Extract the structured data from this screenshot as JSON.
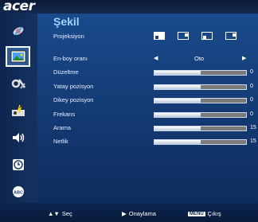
{
  "brand": "acer",
  "title": "Şekil",
  "sidebar": [
    {
      "icon": "color-satellite-icon"
    },
    {
      "icon": "image-picture-icon",
      "active": true
    },
    {
      "icon": "settings-tools-icon"
    },
    {
      "icon": "projector-management-icon"
    },
    {
      "icon": "audio-speaker-icon"
    },
    {
      "icon": "timer-clock-icon"
    },
    {
      "icon": "language-abc-icon"
    }
  ],
  "rows": {
    "projeksiyon": "Projeksiyon",
    "enboy": "En-boy oranı",
    "enboy_value": "Oto",
    "duzeltme": "Düzeltme",
    "yatay": "Yatay pozisyon",
    "dikey": "Dikey pozisyon",
    "frekans": "Frekans",
    "arama": "Arama",
    "netlik": "Netlik"
  },
  "bars": [
    {
      "key": "duzeltme",
      "value": "0",
      "level": 0.5
    },
    {
      "key": "yatay",
      "value": "0",
      "level": 0.5
    },
    {
      "key": "dikey",
      "value": "0",
      "level": 0.5
    },
    {
      "key": "frekans",
      "value": "0",
      "level": 0.5
    },
    {
      "key": "arama",
      "value": "15",
      "level": 0.5
    },
    {
      "key": "netlik",
      "value": "15",
      "level": 0.5
    }
  ],
  "footer": {
    "select": "Seç",
    "confirm": "Onaylama",
    "menu_key": "MENU",
    "exit": "Çıkış"
  }
}
